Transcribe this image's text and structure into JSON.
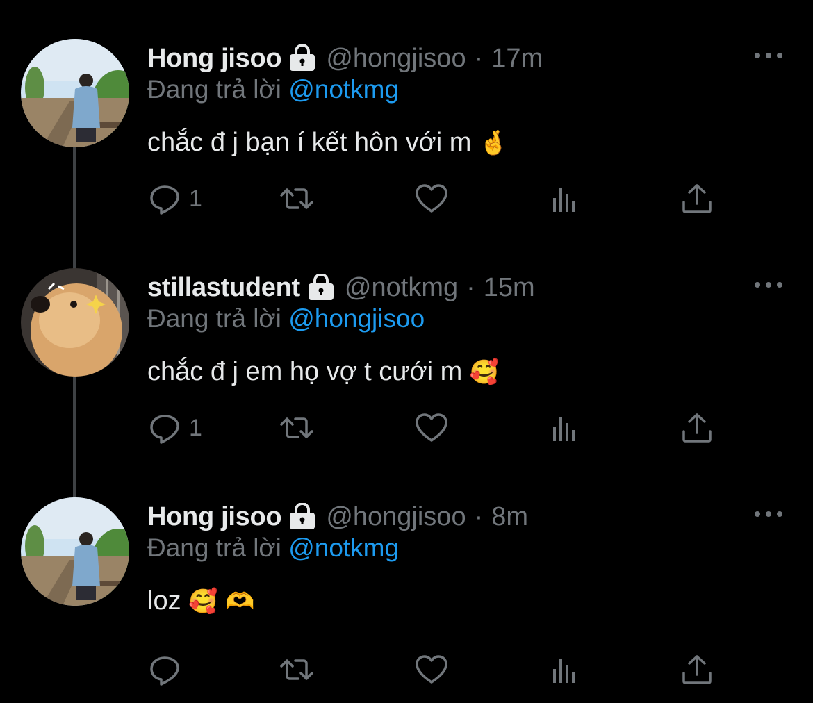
{
  "tweets": [
    {
      "name": "Hong jisoo",
      "handle": "@hongjisoo",
      "time": "17m",
      "replying_prefix": "Đang trả lời",
      "replying_to": "@notkmg",
      "text": "chắc đ j bạn í kết hôn với m",
      "emojis": [
        "🤞"
      ],
      "reply_count": "1",
      "avatar": "person-avatar"
    },
    {
      "name": "stillastudent",
      "handle": "@notkmg",
      "time": "15m",
      "replying_prefix": "Đang trả lời",
      "replying_to": "@hongjisoo",
      "text": "chắc đ j em họ vợ t cưới m",
      "emojis": [
        "🥰"
      ],
      "reply_count": "1",
      "avatar": "dog-avatar"
    },
    {
      "name": "Hong jisoo",
      "handle": "@hongjisoo",
      "time": "8m",
      "replying_prefix": "Đang trả lời",
      "replying_to": "@notkmg",
      "text": "loz",
      "emojis": [
        "🥰",
        "🫶"
      ],
      "reply_count": "",
      "avatar": "person-avatar"
    }
  ],
  "separator": "·",
  "icons": [
    "reply-icon",
    "retweet-icon",
    "like-icon",
    "views-icon",
    "share-icon",
    "lock-icon",
    "more-icon"
  ],
  "colors": {
    "background": "#000000",
    "text": "#e7e9ea",
    "secondary": "#71767b",
    "link": "#1d9bf0",
    "thread_line": "#3e4144"
  }
}
